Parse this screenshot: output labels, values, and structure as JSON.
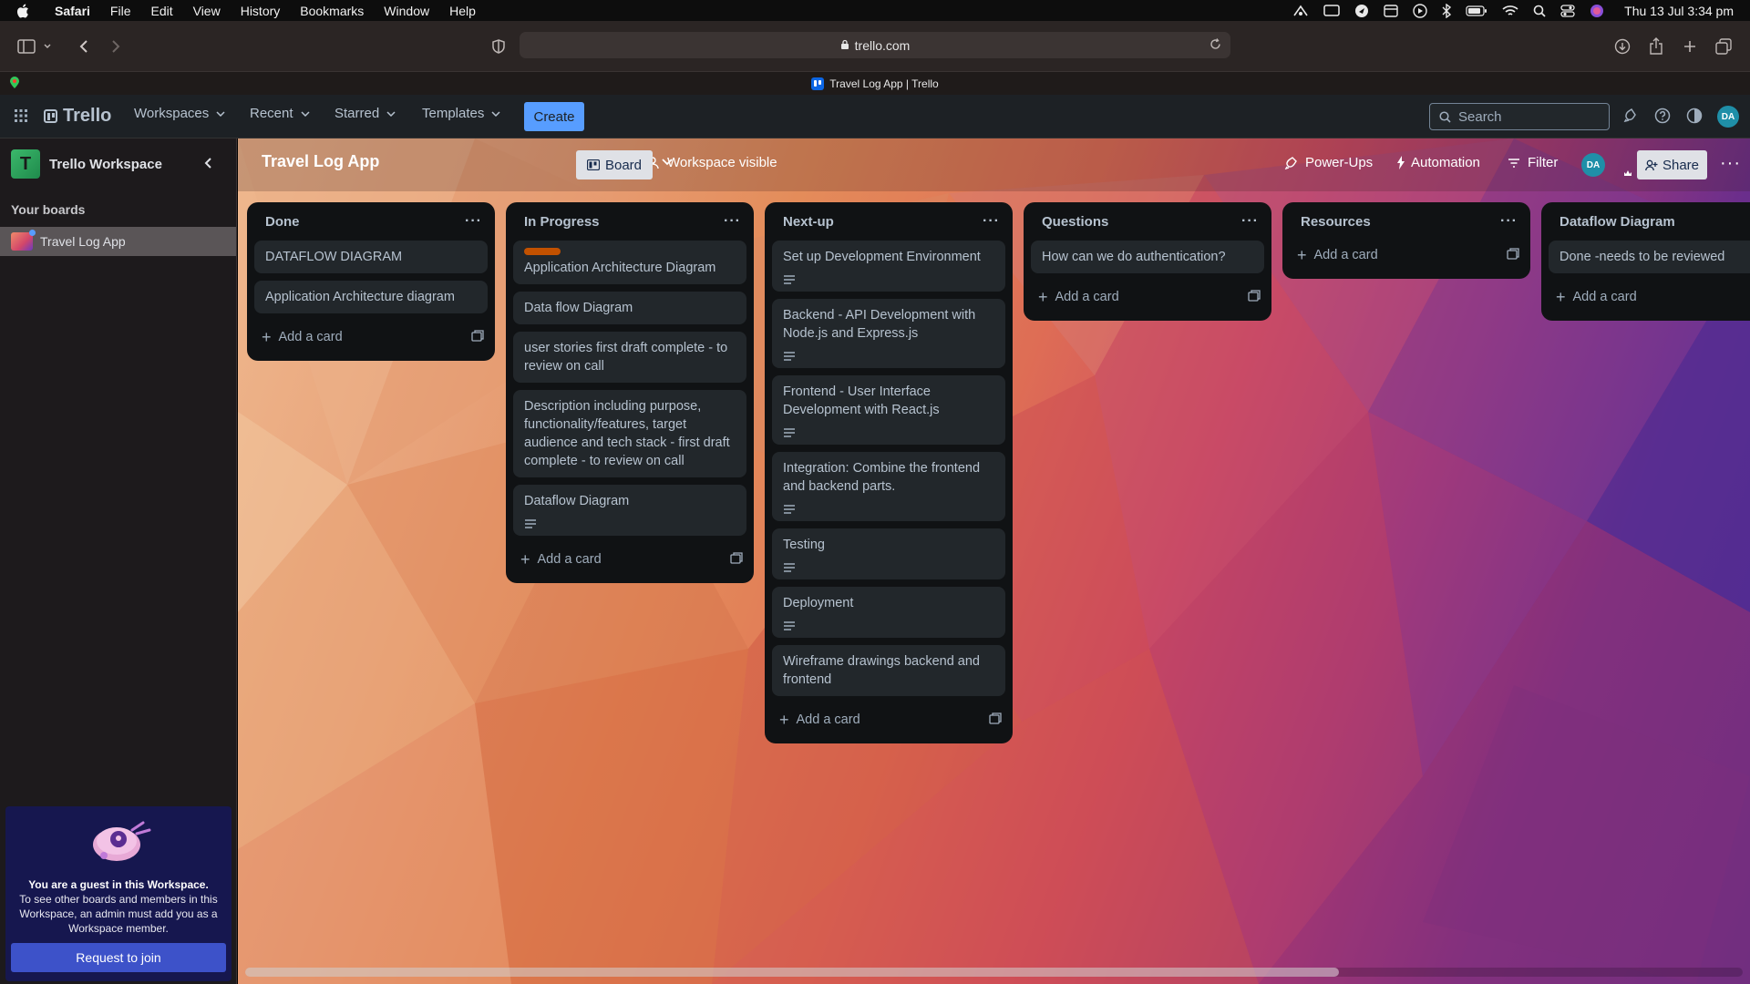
{
  "menubar": {
    "app": "Safari",
    "items": [
      "File",
      "Edit",
      "View",
      "History",
      "Bookmarks",
      "Window",
      "Help"
    ],
    "clock": "Thu 13 Jul  3:34 pm"
  },
  "safari": {
    "url": "trello.com",
    "tab_title": "Travel Log App | Trello"
  },
  "header": {
    "logo": "Trello",
    "nav": [
      "Workspaces",
      "Recent",
      "Starred",
      "Templates"
    ],
    "create": "Create",
    "search_placeholder": "Search",
    "avatar": "DA"
  },
  "sidebar": {
    "workspace_initial": "T",
    "workspace_name": "Trello Workspace",
    "your_boards": "Your boards",
    "boards": [
      "Travel Log App"
    ],
    "guest_title": "You are a guest in this Workspace.",
    "guest_text": "To see other boards and members in this Workspace, an admin must add you as a Workspace member.",
    "join_button": "Request to join"
  },
  "board": {
    "title": "Travel Log App",
    "visibility": "Workspace visible",
    "view": "Board",
    "power_ups": "Power-Ups",
    "automation": "Automation",
    "filter": "Filter",
    "member_avatar": "DA",
    "share": "Share",
    "add_card": "Add a card",
    "colors": {
      "card_bg": "#22272b",
      "list_bg": "#101214",
      "label_orange": "#c25100"
    },
    "lists": [
      {
        "title": "Done",
        "cards": [
          {
            "text": "DATAFLOW DIAGRAM",
            "desc": false,
            "label": false
          },
          {
            "text": "Application Architecture diagram",
            "desc": false,
            "label": false
          }
        ]
      },
      {
        "title": "In Progress",
        "cards": [
          {
            "text": "Application Architecture Diagram",
            "desc": false,
            "label": true
          },
          {
            "text": "Data flow Diagram",
            "desc": false,
            "label": false
          },
          {
            "text": "user stories first draft complete - to review on call",
            "desc": false,
            "label": false
          },
          {
            "text": "Description including purpose, functionality/features, target audience and tech stack - first draft complete - to review on call",
            "desc": false,
            "label": false
          },
          {
            "text": "Dataflow Diagram",
            "desc": true,
            "label": false
          }
        ]
      },
      {
        "title": "Next-up",
        "cards": [
          {
            "text": "Set up Development Environment",
            "desc": true,
            "label": false
          },
          {
            "text": "Backend - API Development with Node.js and Express.js",
            "desc": true,
            "label": false
          },
          {
            "text": "Frontend - User Interface Development with React.js",
            "desc": true,
            "label": false
          },
          {
            "text": "Integration: Combine the frontend and backend parts.",
            "desc": true,
            "label": false
          },
          {
            "text": "Testing",
            "desc": true,
            "label": false
          },
          {
            "text": "Deployment",
            "desc": true,
            "label": false
          },
          {
            "text": "Wireframe drawings backend and frontend",
            "desc": false,
            "label": false
          }
        ]
      },
      {
        "title": "Questions",
        "cards": [
          {
            "text": "How can we do authentication?",
            "desc": false,
            "label": false
          }
        ]
      },
      {
        "title": "Resources",
        "cards": []
      },
      {
        "title": "Dataflow Diagram",
        "cards": [
          {
            "text": "Done -needs to be reviewed",
            "desc": false,
            "label": false
          }
        ]
      }
    ]
  }
}
